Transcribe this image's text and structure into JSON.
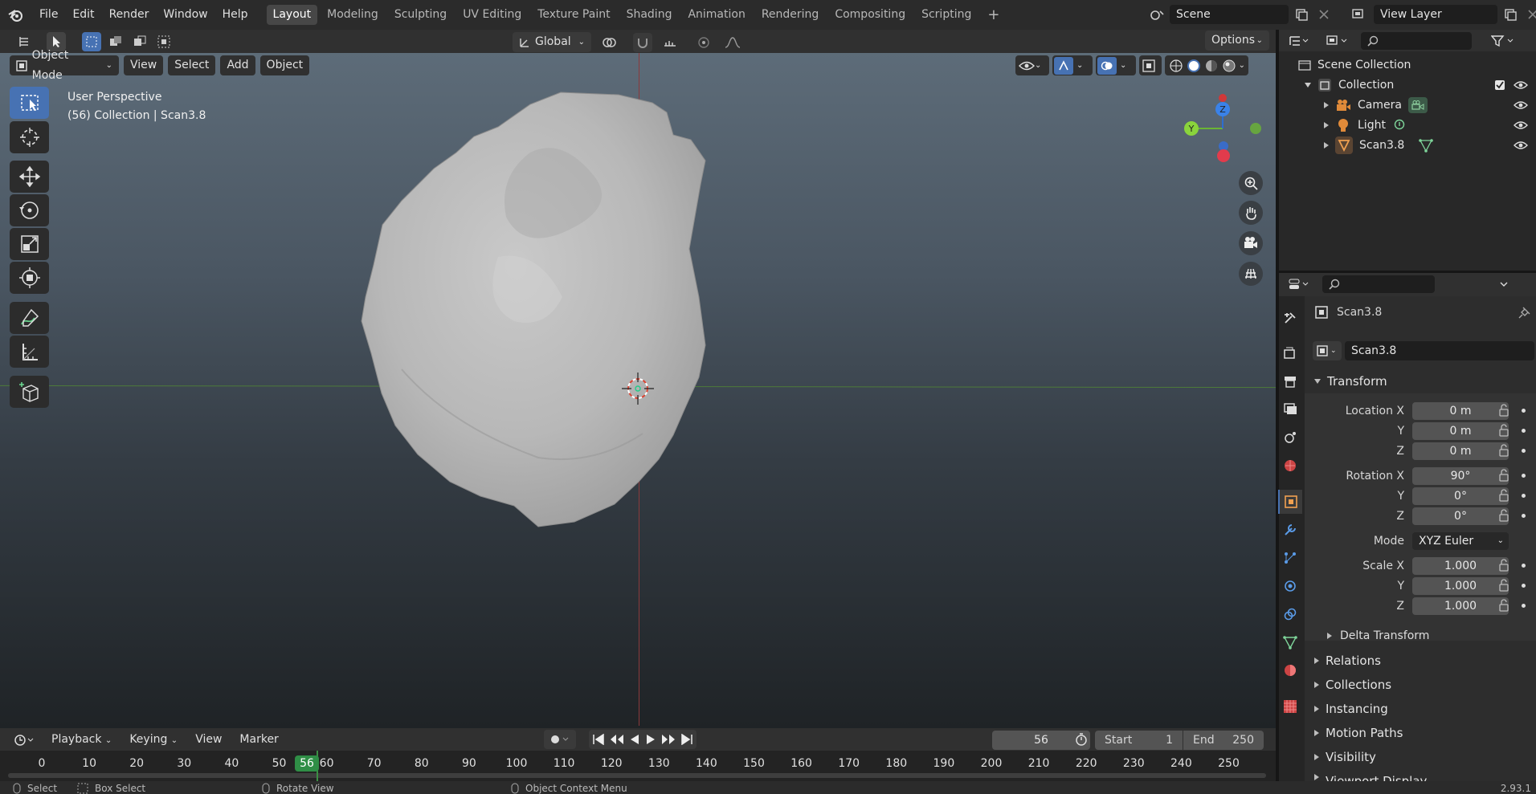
{
  "menu": [
    "File",
    "Edit",
    "Render",
    "Window",
    "Help"
  ],
  "workspaces": [
    "Layout",
    "Modeling",
    "Sculpting",
    "UV Editing",
    "Texture Paint",
    "Shading",
    "Animation",
    "Rendering",
    "Compositing",
    "Scripting"
  ],
  "active_workspace": "Layout",
  "scene": {
    "name": "Scene"
  },
  "view_layer": {
    "name": "View Layer"
  },
  "toolbar": {
    "orientation": "Global",
    "options": "Options"
  },
  "viewport": {
    "mode": "Object Mode",
    "menus": [
      "View",
      "Select",
      "Add",
      "Object"
    ],
    "info_line1": "User Perspective",
    "info_line2": "(56) Collection | Scan3.8",
    "gizmo": {
      "y": "Y",
      "z": "Z"
    }
  },
  "outliner": {
    "root": "Scene Collection",
    "collection": "Collection",
    "items": [
      "Camera",
      "Light",
      "Scan3.8"
    ]
  },
  "properties": {
    "object_name": "Scan3.8",
    "data_name": "Scan3.8",
    "transform_title": "Transform",
    "location_label": "Location X",
    "loc_x": "0 m",
    "loc_y": "0 m",
    "loc_z": "0 m",
    "rotation_label": "Rotation X",
    "rot_x": "90°",
    "rot_y": "0°",
    "rot_z": "0°",
    "mode_label": "Mode",
    "mode": "XYZ Euler",
    "scale_label": "Scale X",
    "scale_x": "1.000",
    "scale_y": "1.000",
    "scale_z": "1.000",
    "y": "Y",
    "z": "Z",
    "delta": "Delta Transform",
    "sections": [
      "Relations",
      "Collections",
      "Instancing",
      "Motion Paths",
      "Visibility",
      "Viewport Display"
    ]
  },
  "timeline": {
    "menus": [
      "Playback",
      "Keying",
      "View",
      "Marker"
    ],
    "current_frame": "56",
    "start_label": "Start",
    "start": "1",
    "end_label": "End",
    "end": "250",
    "ticks": [
      "0",
      "10",
      "20",
      "30",
      "40",
      "50",
      "60",
      "70",
      "80",
      "90",
      "100",
      "110",
      "120",
      "130",
      "140",
      "150",
      "160",
      "170",
      "180",
      "190",
      "200",
      "210",
      "220",
      "230",
      "240",
      "250"
    ]
  },
  "statusbar": {
    "select": "Select",
    "box_select": "Box Select",
    "rotate_view": "Rotate View",
    "context_menu": "Object Context Menu",
    "version": "2.93.1"
  }
}
